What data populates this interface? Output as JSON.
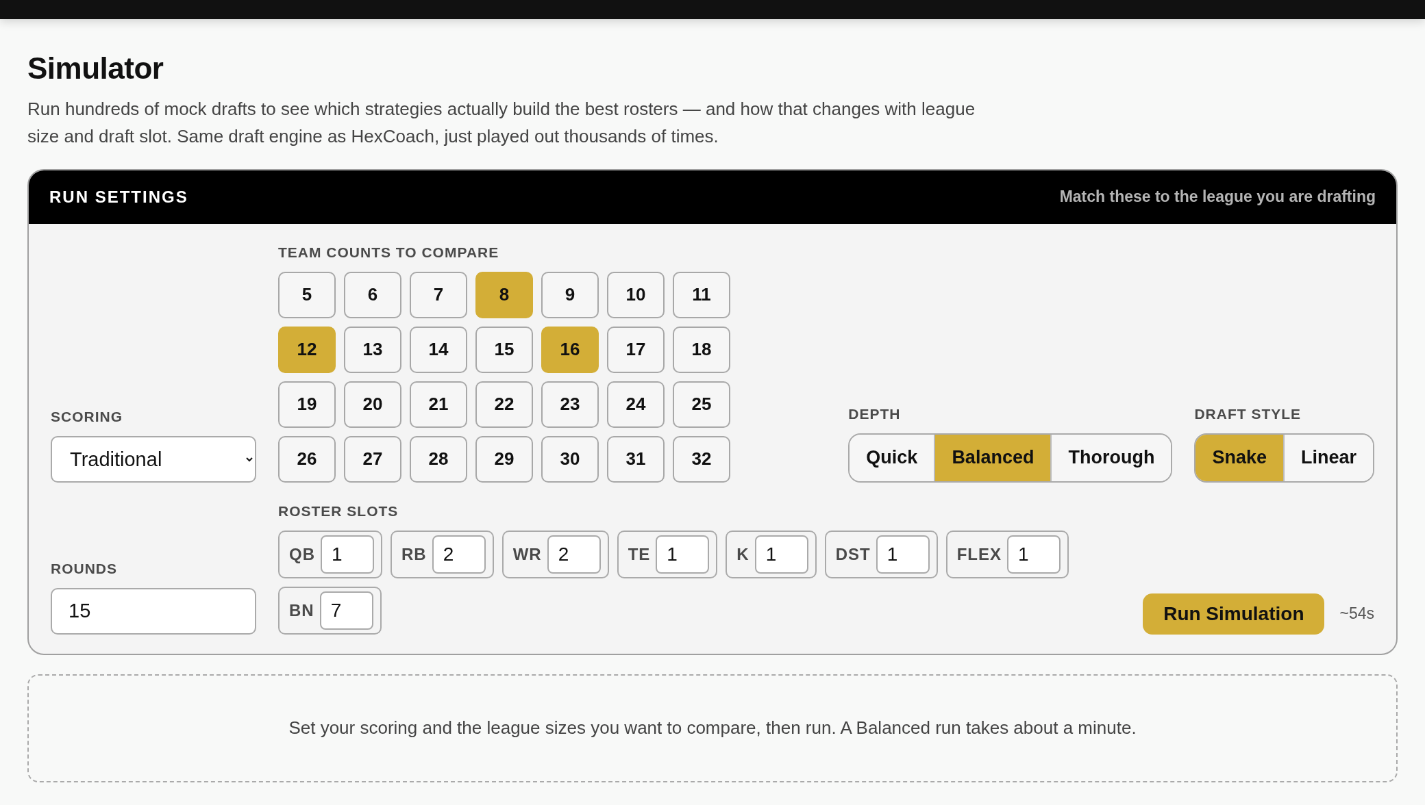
{
  "page": {
    "title": "Simulator",
    "description": "Run hundreds of mock drafts to see which strategies actually build the best rosters — and how that changes with league size and draft slot. Same draft engine as HexCoach, just played out thousands of times."
  },
  "run_settings": {
    "title": "RUN SETTINGS",
    "subtitle": "Match these to the league you are drafting",
    "scoring": {
      "label": "SCORING",
      "value": "Traditional"
    },
    "rounds": {
      "label": "ROUNDS",
      "value": "15"
    },
    "team_counts": {
      "label": "TEAM COUNTS TO COMPARE",
      "options": [
        {
          "label": "5",
          "selected": false
        },
        {
          "label": "6",
          "selected": false
        },
        {
          "label": "7",
          "selected": false
        },
        {
          "label": "8",
          "selected": true
        },
        {
          "label": "9",
          "selected": false
        },
        {
          "label": "10",
          "selected": false
        },
        {
          "label": "11",
          "selected": false
        },
        {
          "label": "12",
          "selected": true
        },
        {
          "label": "13",
          "selected": false
        },
        {
          "label": "14",
          "selected": false
        },
        {
          "label": "15",
          "selected": false
        },
        {
          "label": "16",
          "selected": true
        },
        {
          "label": "17",
          "selected": false
        },
        {
          "label": "18",
          "selected": false
        },
        {
          "label": "19",
          "selected": false
        },
        {
          "label": "20",
          "selected": false
        },
        {
          "label": "21",
          "selected": false
        },
        {
          "label": "22",
          "selected": false
        },
        {
          "label": "23",
          "selected": false
        },
        {
          "label": "24",
          "selected": false
        },
        {
          "label": "25",
          "selected": false
        },
        {
          "label": "26",
          "selected": false
        },
        {
          "label": "27",
          "selected": false
        },
        {
          "label": "28",
          "selected": false
        },
        {
          "label": "29",
          "selected": false
        },
        {
          "label": "30",
          "selected": false
        },
        {
          "label": "31",
          "selected": false
        },
        {
          "label": "32",
          "selected": false
        }
      ]
    },
    "depth": {
      "label": "DEPTH",
      "options": [
        {
          "label": "Quick",
          "selected": false
        },
        {
          "label": "Balanced",
          "selected": true
        },
        {
          "label": "Thorough",
          "selected": false
        }
      ]
    },
    "draft_style": {
      "label": "DRAFT STYLE",
      "options": [
        {
          "label": "Snake",
          "selected": true
        },
        {
          "label": "Linear",
          "selected": false
        }
      ]
    },
    "roster_slots": {
      "label": "ROSTER SLOTS",
      "slots": [
        {
          "label": "QB",
          "value": "1"
        },
        {
          "label": "RB",
          "value": "2"
        },
        {
          "label": "WR",
          "value": "2"
        },
        {
          "label": "TE",
          "value": "1"
        },
        {
          "label": "K",
          "value": "1"
        },
        {
          "label": "DST",
          "value": "1"
        },
        {
          "label": "FLEX",
          "value": "1"
        },
        {
          "label": "BN",
          "value": "7"
        }
      ]
    },
    "run_button": "Run Simulation",
    "estimate": "~54s"
  },
  "hint": "Set your scoring and the league sizes you want to compare, then run. A Balanced run takes about a minute."
}
